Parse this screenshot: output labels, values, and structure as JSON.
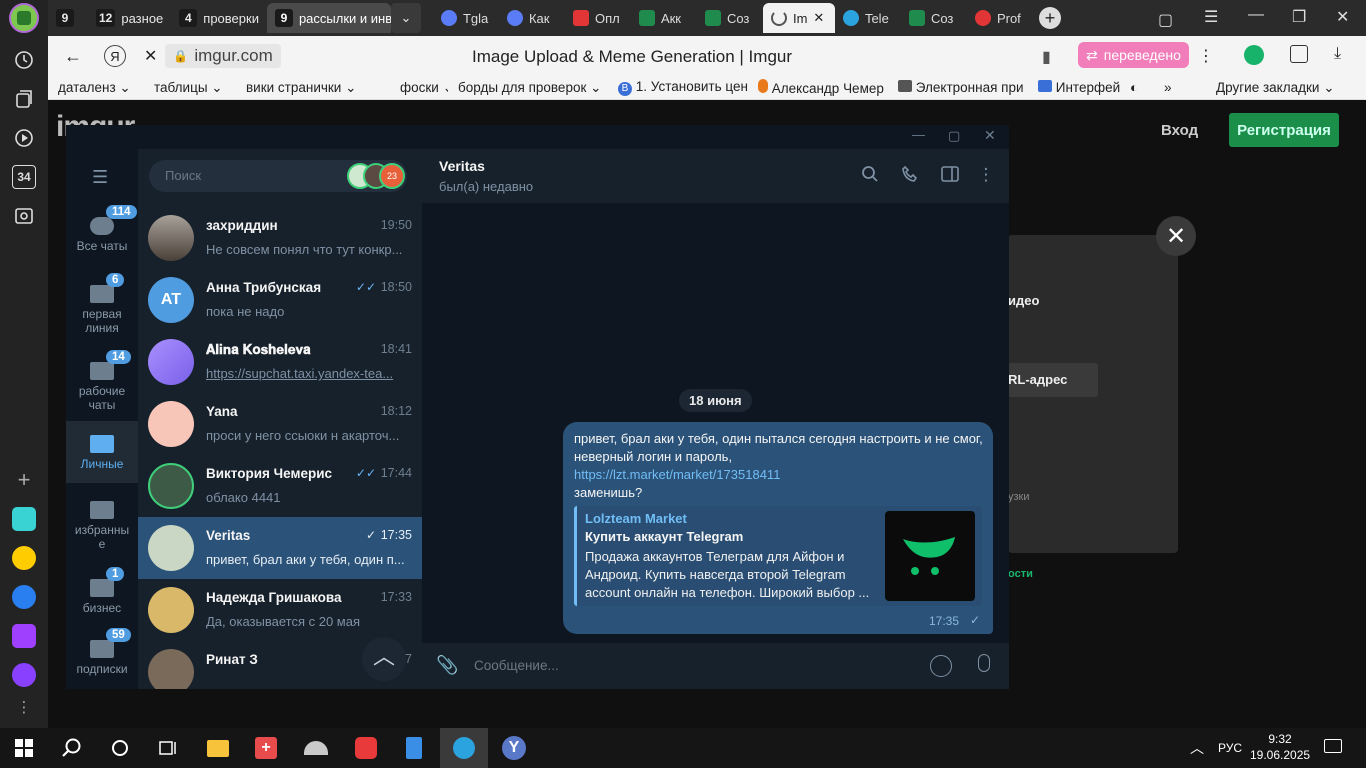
{
  "browser": {
    "tab_groups": [
      {
        "num": "9",
        "label": ""
      },
      {
        "num": "12",
        "label": "разное"
      },
      {
        "num": "4",
        "label": "проверки"
      },
      {
        "num": "9",
        "label": "рассылки и инв"
      }
    ],
    "tabs": [
      {
        "label": "Tgla",
        "color": "#5b7cf7"
      },
      {
        "label": "Как",
        "color": "#5b7cf7"
      },
      {
        "label": "Опл",
        "color": "#e23636"
      },
      {
        "label": "Акк",
        "color": "#1f8b4c"
      },
      {
        "label": "Соз",
        "color": "#1f8b4c"
      },
      {
        "label": "Im",
        "color": "#888888"
      },
      {
        "label": "Tele",
        "color": "#2aa3df"
      },
      {
        "label": "Соз",
        "color": "#1f8b4c"
      },
      {
        "label": "Prof",
        "color": "#e23636"
      }
    ],
    "url": "imgur.com",
    "page_title": "Image Upload & Meme Generation | Imgur",
    "translated_badge": "переведено",
    "bookmarks": [
      "даталенз",
      "таблицы",
      "вики странички",
      "фоски",
      "борды для проверок",
      "1. Установить цен",
      "Александр Чемер",
      "Электронная при",
      "Интерфей",
      "Другие закладки"
    ],
    "sidebar_counter": "34"
  },
  "imgur": {
    "logo": "imgur",
    "login": "Вход",
    "register": "Регистрация",
    "modal_text_1": "идео",
    "modal_text_2": "RL-адрес",
    "modal_text_3": "узки",
    "modal_text_4": "ости"
  },
  "telegram": {
    "search_placeholder": "Поиск",
    "folders": [
      {
        "label": "Все чаты",
        "badge": "114"
      },
      {
        "label": "первая линия",
        "badge": "6"
      },
      {
        "label": "рабочие чаты",
        "badge": "14"
      },
      {
        "label": "Личные",
        "badge": ""
      },
      {
        "label": "избранные",
        "badge": ""
      },
      {
        "label": "бизнес",
        "badge": "1"
      },
      {
        "label": "подписки",
        "badge": "59"
      }
    ],
    "chats": [
      {
        "name": "захриддин",
        "time": "19:50",
        "preview": "Не совсем понял что тут конкр...",
        "check": "",
        "avatar": ""
      },
      {
        "name": "Анна Трибунская",
        "time": "18:50",
        "preview": "пока не надо",
        "check": "✓✓",
        "avatar": "AT"
      },
      {
        "name": "𝐀𝐥𝐢𝐧𝐚 𝐊𝐨𝐬𝐡𝐞𝐥𝐞𝐯𝐚",
        "time": "18:41",
        "preview": "https://supchat.taxi.yandex-tea...",
        "check": "",
        "avatar": ""
      },
      {
        "name": "Yana",
        "time": "18:12",
        "preview": "проси у него ссыоки н акарточ...",
        "check": "",
        "avatar": ""
      },
      {
        "name": "Виктория Чемерис",
        "time": "17:44",
        "preview": "облако 4441",
        "check": "✓✓",
        "avatar": ""
      },
      {
        "name": "Veritas",
        "time": "17:35",
        "preview": "привет, брал аки у тебя, один п...",
        "check": "✓",
        "avatar": ""
      },
      {
        "name": "Надежда Гришакова",
        "time": "17:33",
        "preview": "Да, оказывается с 20 мая",
        "check": "",
        "avatar": ""
      },
      {
        "name": "Ринат З",
        "time": "17:57",
        "preview": "",
        "check": "",
        "avatar": ""
      }
    ],
    "active_chat": {
      "name": "Veritas",
      "status": "был(а) недавно",
      "date": "18 июня",
      "message_text_1": "привет, брал аки у тебя, один  пытался сегодня настроить и не смог, неверный логин и пароль,",
      "message_link": "https://lzt.market/market/173518411",
      "message_text_2": "заменишь?",
      "preview_site": "Lolzteam Market",
      "preview_title": "Купить аккаунт Telegram",
      "preview_desc": "Продажа аккаунтов Телеграм для Айфон и Андроид. Купить навсегда второй Telegram account онлайн на телефон. Широкий выбор ...",
      "time": "17:35",
      "check": "✓"
    },
    "composer_placeholder": "Сообщение..."
  },
  "taskbar": {
    "lang": "РУС",
    "time": "9:32",
    "date": "19.06.2025"
  }
}
